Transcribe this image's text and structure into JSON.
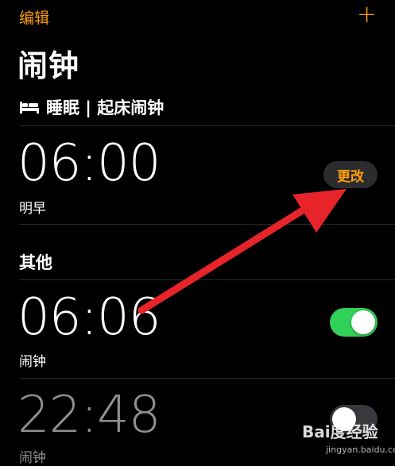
{
  "nav": {
    "edit_label": "编辑",
    "add_label": "+"
  },
  "page_title": "闹钟",
  "sleep": {
    "icon": "bed-icon",
    "header": "睡眠 | 起床闹钟",
    "alarm": {
      "time": "06:00",
      "label": "明早",
      "change_label": "更改"
    }
  },
  "other": {
    "section_title": "其他",
    "alarms": [
      {
        "time": "06:06",
        "label": "闹钟",
        "enabled": true
      },
      {
        "time": "22:48",
        "label": "闹钟",
        "enabled": false
      }
    ]
  },
  "watermark": {
    "text": "Bai度经验",
    "url": "jingyan.baidu.com"
  },
  "colors": {
    "accent": "#ff9f0a",
    "toggle_on": "#30d158",
    "annotation_arrow": "#e8242b"
  }
}
